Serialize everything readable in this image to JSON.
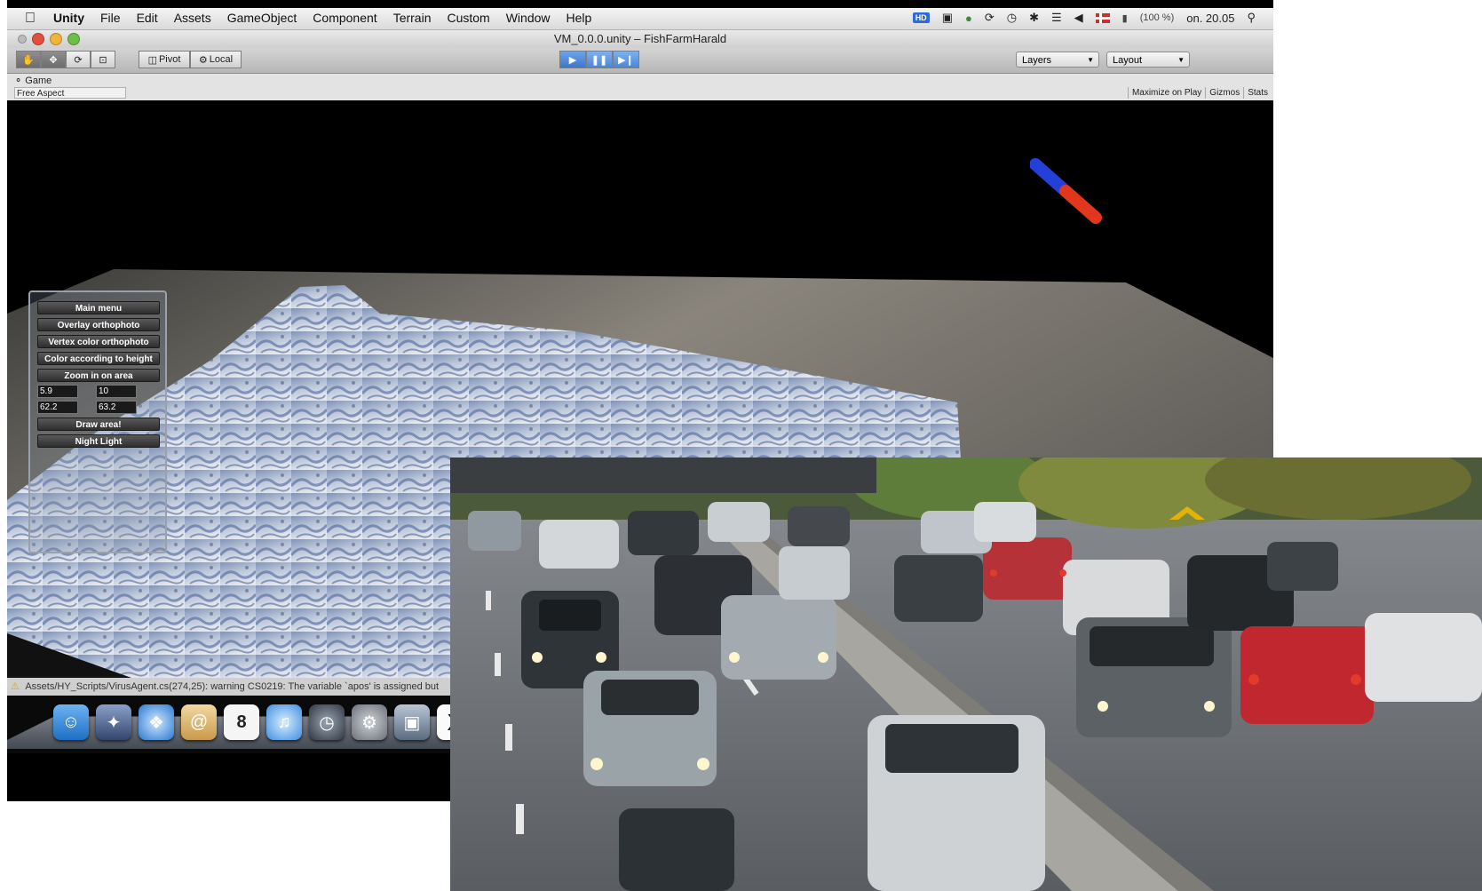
{
  "menubar": {
    "items": [
      "Unity",
      "File",
      "Edit",
      "Assets",
      "GameObject",
      "Component",
      "Terrain",
      "Custom",
      "Window",
      "Help"
    ],
    "battery": "(100 %)",
    "clock": "on. 20.05",
    "hd_badge": "HD"
  },
  "window": {
    "title": "VM_0.0.0.unity – FishFarmHarald"
  },
  "toolbar": {
    "pivot_label": "Pivot",
    "local_label": "Local",
    "layers_label": "Layers",
    "layout_label": "Layout"
  },
  "game_view": {
    "tab_label": "Game",
    "aspect_label": "Free Aspect",
    "maximize_label": "Maximize on Play",
    "gizmos_label": "Gizmos",
    "stats_label": "Stats"
  },
  "gui_panel": {
    "main_menu": "Main menu",
    "overlay_orthophoto": "Overlay orthophoto",
    "vertex_color": "Vertex color orthophoto",
    "color_height": "Color according to height",
    "zoom_area": "Zoom in on area",
    "field1": "5.9",
    "field2": "10",
    "field3": "62.2",
    "field4": "63.2",
    "draw_area": "Draw area!",
    "night_light": "Night Light"
  },
  "status": {
    "message": "Assets/HY_Scripts/VirusAgent.cs(274,25): warning CS0219: The variable `apos' is assigned but"
  },
  "dock": {
    "calendar_day": "8"
  },
  "colors": {
    "accent_play": "#3a77cc",
    "warning": "#e0a400",
    "terrain_snow": "#d7dde8",
    "terrain_water": "#5f78a8"
  }
}
